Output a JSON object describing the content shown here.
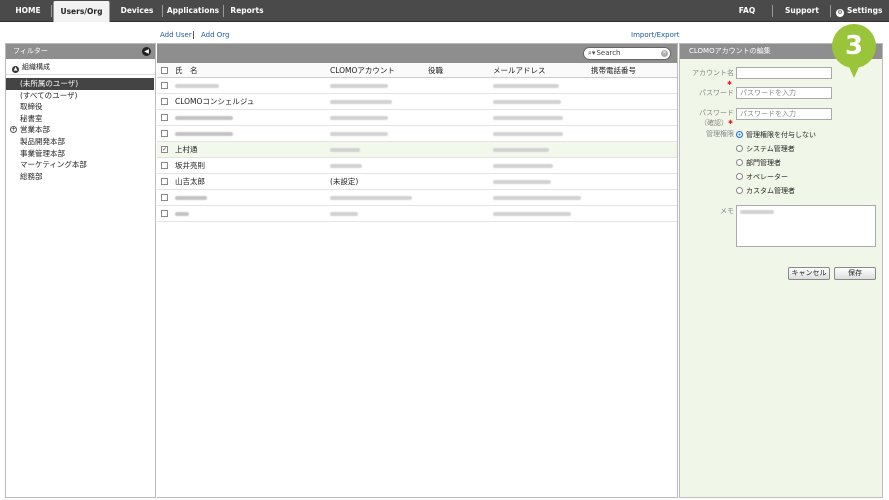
{
  "nav": {
    "home": "HOME",
    "users_org": "Users/Org",
    "devices": "Devices",
    "applications": "Applications",
    "reports": "Reports",
    "faq": "FAQ",
    "support": "Support",
    "settings": "Settings"
  },
  "sub": {
    "add_user": "Add User",
    "add_org": "Add Org",
    "import_export": "Import/Export"
  },
  "filter": {
    "title": "フィルター",
    "org_label": "組織構成",
    "items": [
      "(未所属のユーザ)",
      "(すべてのユーザ)",
      "取締役",
      "秘書室",
      "営業本部",
      "製品開発本部",
      "事業管理本部",
      "マーケティング本部",
      "総務部"
    ]
  },
  "list": {
    "search_placeholder": "Search",
    "headers": {
      "name": "氏　名",
      "account": "CLOMOアカウント",
      "position": "役職",
      "email": "メールアドレス",
      "phone": "携帯電話番号"
    },
    "rows": [
      {
        "name": "",
        "account": ""
      },
      {
        "name": "CLOMOコンシェルジュ",
        "account": ""
      },
      {
        "name": "",
        "account": ""
      },
      {
        "name": "",
        "account": ""
      },
      {
        "name": "上村通",
        "account": ""
      },
      {
        "name": "坂井亮則",
        "account": ""
      },
      {
        "name": "山吉太郎",
        "account": "(未設定)"
      },
      {
        "name": "",
        "account": ""
      },
      {
        "name": "",
        "account": ""
      }
    ]
  },
  "edit": {
    "title": "CLOMOアカウントの編集",
    "account_label": "アカウント名",
    "password_label": "パスワード",
    "password_placeholder": "パスワードを入力",
    "password_confirm_label_1": "パスワード",
    "password_confirm_label_2": "（確認）",
    "password_confirm_placeholder": "パスワードを入力",
    "role_label": "管理権限",
    "roles": [
      "管理権限を付与しない",
      "システム管理者",
      "部門管理者",
      "オペレーター",
      "カスタム管理者"
    ],
    "selected_role": "管理権限を付与しない",
    "memo_label": "メモ",
    "cancel": "キャンセル",
    "save": "保存"
  },
  "badge": "3",
  "colors": {
    "badge": "#9ac43a",
    "link": "#1c5aa6",
    "selected_radio": "#1d6fd8",
    "topbar": "#4a4a4a"
  }
}
